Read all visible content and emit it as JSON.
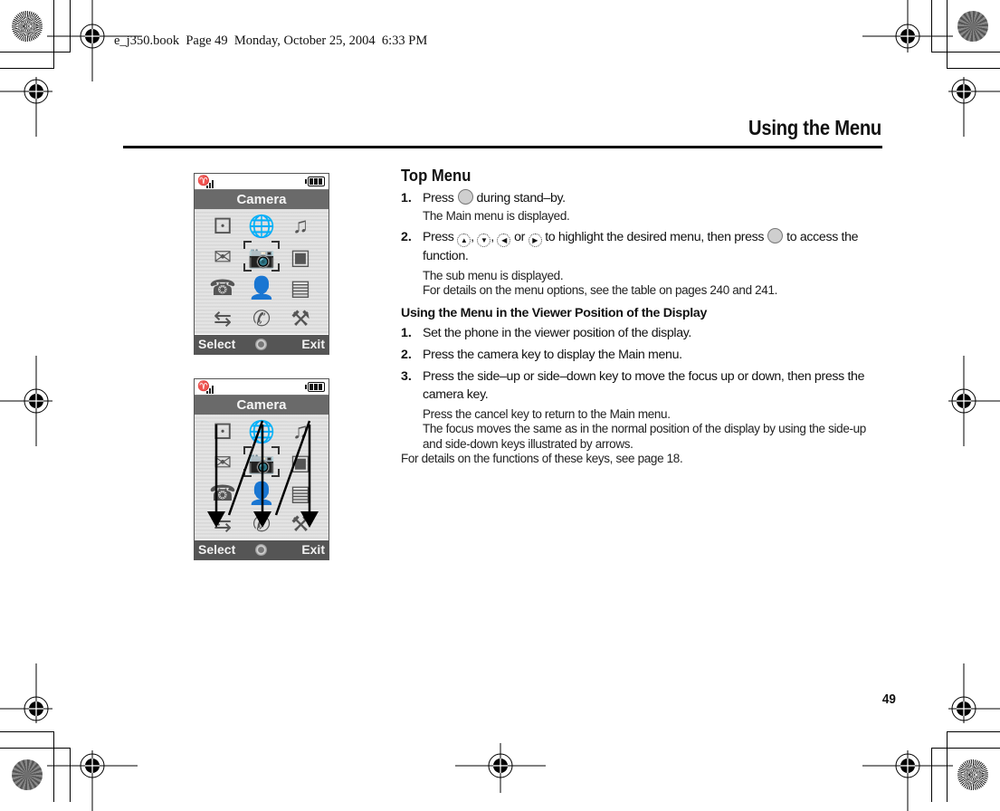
{
  "print_stamp": "e_j350.book  Page 49  Monday, October 25, 2004  6:33 PM",
  "header": {
    "title": "Using the Menu"
  },
  "page_number": "49",
  "phone_screens": [
    {
      "id": "normal",
      "status": {
        "antenna_icon": "antenna-icon",
        "signal_bars": 3,
        "battery_bars": 3
      },
      "title": "Camera",
      "menu_icons": [
        "dice-icon",
        "globe-icon",
        "media-icon",
        "envelope-icon",
        "camera-icon",
        "memory-card-icon",
        "phonebook-icon",
        "contact-icon",
        "sim-card-icon",
        "sync-icon",
        "data-phone-icon",
        "settings-icon"
      ],
      "focused_item": "camera-icon",
      "softkeys": {
        "left": "Select",
        "center_icon": "nav-key-icon",
        "right": "Exit"
      },
      "show_arrows": false
    },
    {
      "id": "viewer",
      "status": {
        "antenna_icon": "antenna-icon",
        "signal_bars": 3,
        "battery_bars": 3
      },
      "title": "Camera",
      "menu_icons": [
        "dice-icon",
        "globe-icon",
        "media-icon",
        "envelope-icon",
        "camera-icon",
        "memory-card-icon",
        "phonebook-icon",
        "contact-icon",
        "sim-card-icon",
        "sync-icon",
        "data-phone-icon",
        "settings-icon"
      ],
      "focused_item": "camera-icon",
      "softkeys": {
        "left": "Select",
        "center_icon": "nav-key-icon",
        "right": "Exit"
      },
      "show_arrows": true
    }
  ],
  "top_menu": {
    "heading": "Top Menu",
    "steps": [
      {
        "num": "1.",
        "parts": {
          "before": "Press",
          "after": "during stand–by."
        },
        "notes": [
          "The Main menu is displayed."
        ]
      },
      {
        "num": "2.",
        "parts": {
          "before": "Press",
          "sep1": ",",
          "sep2": ",",
          "or": "or",
          "middle": "to highlight the desired menu, then press",
          "after": "to access the function."
        },
        "nav_keys": [
          "▲",
          "▼",
          "◀",
          "▶"
        ],
        "notes": [
          "The sub menu is displayed.",
          "For details on the menu options, see the table on pages 240 and 241."
        ]
      }
    ]
  },
  "viewer_section": {
    "heading": "Using the Menu in the Viewer Position of the Display",
    "steps": [
      {
        "num": "1.",
        "text": "Set the phone in the viewer position of the display."
      },
      {
        "num": "2.",
        "text": "Press the camera key to display the Main menu."
      },
      {
        "num": "3.",
        "text": "Press the side–up or side–down key to move the focus up or down, then press the camera key."
      }
    ],
    "notes": [
      "Press the cancel key to return to the Main menu.",
      "The focus moves the same as in the normal position of the display by using the side-up and side-down keys illustrated by arrows."
    ],
    "footer": "For details on the functions of these keys, see page 18."
  }
}
